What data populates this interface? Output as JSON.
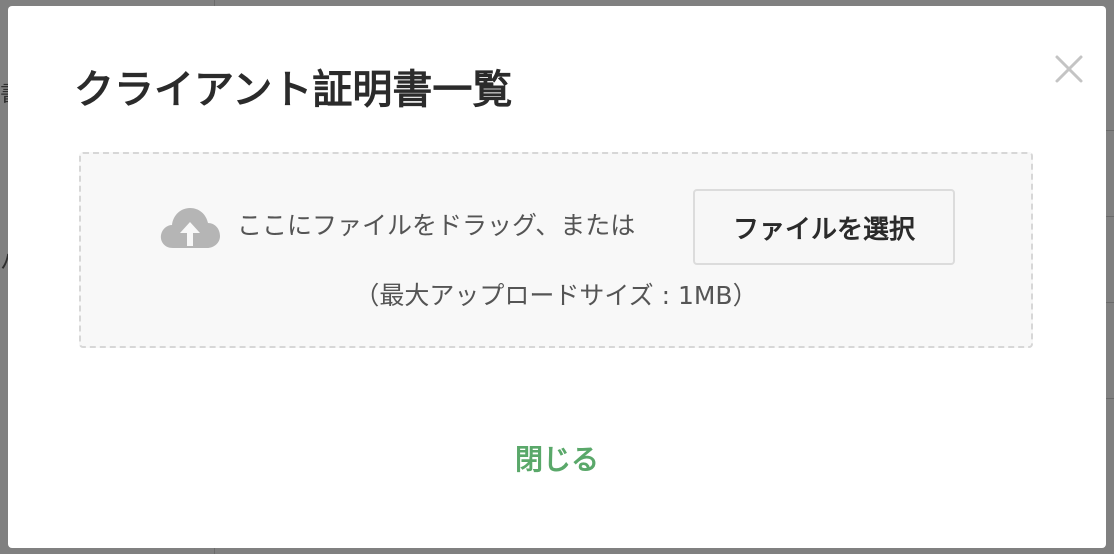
{
  "modal": {
    "title": "クライアント証明書一覧",
    "close_icon": "close-icon",
    "dropzone": {
      "upload_icon": "cloud-upload-icon",
      "drop_text": "ここにファイルをドラッグ、または",
      "select_button_label": "ファイルを選択",
      "max_size_text": "（最大アップロードサイズ : 1MB）"
    },
    "close_link_label": "閉じる"
  },
  "colors": {
    "overlay": "#808080",
    "accent_green": "#5aa86a",
    "dropzone_border": "#d7d7d7",
    "dropzone_bg": "#f8f8f8",
    "icon_gray": "#b5b5b5"
  }
}
